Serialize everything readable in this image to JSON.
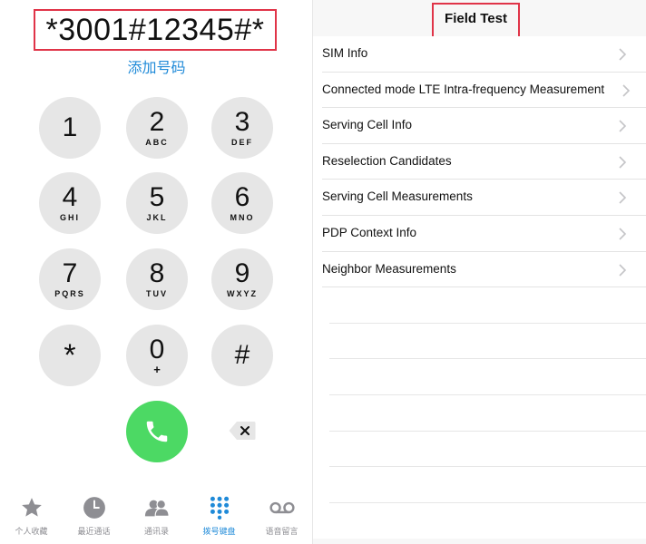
{
  "dialer": {
    "number": "*3001#12345#*",
    "add_number": "添加号码",
    "keys": [
      {
        "digit": "1",
        "letters": ""
      },
      {
        "digit": "2",
        "letters": "ABC"
      },
      {
        "digit": "3",
        "letters": "DEF"
      },
      {
        "digit": "4",
        "letters": "GHI"
      },
      {
        "digit": "5",
        "letters": "JKL"
      },
      {
        "digit": "6",
        "letters": "MNO"
      },
      {
        "digit": "7",
        "letters": "PQRS"
      },
      {
        "digit": "8",
        "letters": "TUV"
      },
      {
        "digit": "9",
        "letters": "WXYZ"
      },
      {
        "digit": "*",
        "letters": ""
      },
      {
        "digit": "0",
        "letters": "+"
      },
      {
        "digit": "#",
        "letters": ""
      }
    ],
    "call_icon": "phone-icon",
    "delete_icon": "backspace-icon",
    "accent_color": "#1f8ad8",
    "call_color": "#4cd964",
    "highlight_color": "#e03448"
  },
  "tabbar": {
    "tabs": [
      {
        "label": "个人收藏",
        "icon": "star-icon",
        "active": false
      },
      {
        "label": "最近通话",
        "icon": "clock-icon",
        "active": false
      },
      {
        "label": "通讯录",
        "icon": "contacts-icon",
        "active": false
      },
      {
        "label": "拨号键盘",
        "icon": "keypad-icon",
        "active": true
      },
      {
        "label": "语音留言",
        "icon": "voicemail-icon",
        "active": false
      }
    ]
  },
  "field_test": {
    "title": "Field Test",
    "items": [
      {
        "label": "SIM Info"
      },
      {
        "label": "Connected mode LTE Intra-frequency Measurement"
      },
      {
        "label": "Serving Cell Info"
      },
      {
        "label": "Reselection Candidates"
      },
      {
        "label": "Serving Cell Measurements"
      },
      {
        "label": "PDP Context Info"
      },
      {
        "label": "Neighbor Measurements"
      }
    ]
  }
}
